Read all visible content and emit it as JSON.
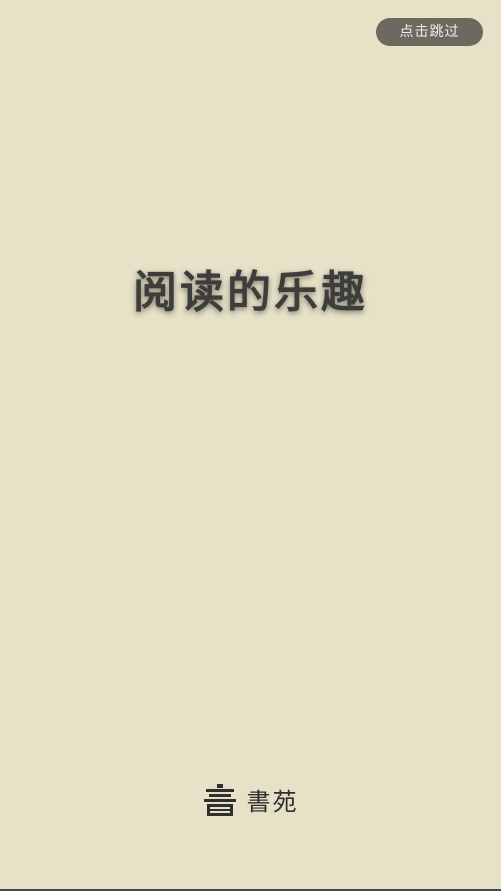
{
  "skip": {
    "label": "点击跳过"
  },
  "splash": {
    "slogan": "阅读的乐趣"
  },
  "brand": {
    "name": "書苑",
    "logo_icon": "book-logo-icon"
  },
  "colors": {
    "background": "#e6e1c7",
    "skip_button_bg": "#6b6a60",
    "text_dark": "#3d3d3b"
  }
}
